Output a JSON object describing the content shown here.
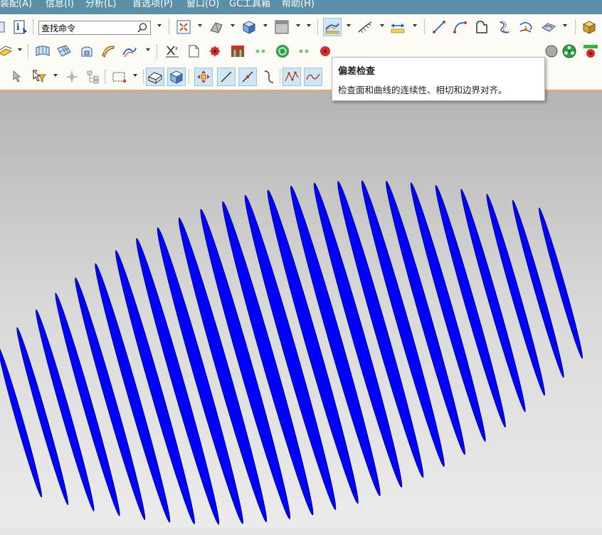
{
  "menu": {
    "items": [
      "装配(A)",
      "信息(I)",
      "分析(L)",
      "首选项(P)",
      "窗口(O)",
      "GC工具箱",
      "帮助(H)"
    ]
  },
  "search": {
    "value": "查找命令",
    "icon": "magnifier-icon"
  },
  "toolbar": {
    "active_tool": "deviation-check-button",
    "accent_color": "#cfe6f4"
  },
  "tooltip": {
    "title": "偏差检查",
    "description": "检查面和曲线的连续性、相切和边界对齐。"
  },
  "viewport": {
    "stripe_color": "#0000ff",
    "stripe_count": 25
  }
}
